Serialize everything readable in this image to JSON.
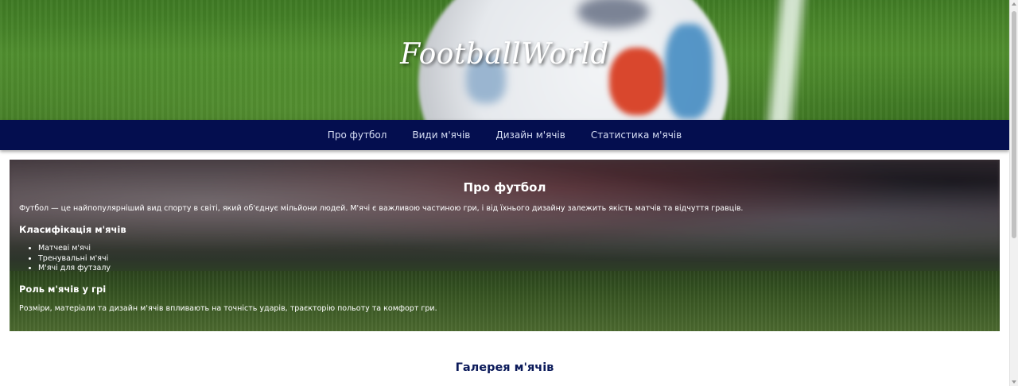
{
  "header": {
    "brand": "FootballWorld"
  },
  "nav": {
    "items": [
      {
        "label": "Про футбол"
      },
      {
        "label": "Види м'ячів"
      },
      {
        "label": "Дизайн м'ячів"
      },
      {
        "label": "Статистика м'ячів"
      }
    ]
  },
  "about": {
    "title": "Про футбол",
    "intro": "Футбол — це найпопулярніший вид спорту в світі, який об'єднує мільйони людей. М'ячі є важливою частиною гри, і від їхнього дизайну залежить якість матчів та відчуття гравців.",
    "classification_heading": "Класифікація м'ячів",
    "classification_items": [
      "Матчеві м'ячі",
      "Тренувальні м'ячі",
      "М'ячі для футзалу"
    ],
    "role_heading": "Роль м'ячів у грі",
    "role_text": "Розміри, матеріали та дизайн м'ячів впливають на точність ударів, траєкторію польоту та комфорт гри."
  },
  "gallery": {
    "title": "Галерея м'ячів"
  },
  "colors": {
    "nav_background": "#040e4f",
    "gallery_title": "#0b1a5a"
  }
}
